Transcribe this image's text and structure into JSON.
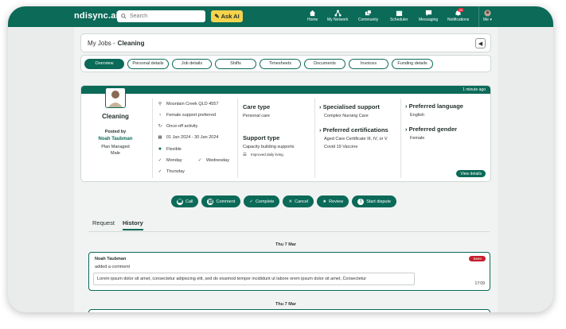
{
  "app": {
    "logo": "ndisync.ai"
  },
  "search": {
    "placeholder": "Search"
  },
  "ask_ai": {
    "label": "Ask AI"
  },
  "nav": [
    {
      "label": "Home",
      "icon": "home-icon"
    },
    {
      "label": "My Network",
      "icon": "network-icon"
    },
    {
      "label": "Community",
      "icon": "community-icon"
    },
    {
      "label": "Scheduler",
      "icon": "scheduler-icon"
    },
    {
      "label": "Messaging",
      "icon": "messaging-icon"
    },
    {
      "label": "Notifications",
      "icon": "bell-icon",
      "badge": "20"
    },
    {
      "label": "Me ▾",
      "icon": "avatar"
    }
  ],
  "breadcrumb": {
    "prefix": "My Jobs - ",
    "current": "Cleaning"
  },
  "tabs": [
    "Overview",
    "Personal details",
    "Job details",
    "Shifts",
    "Timesheets",
    "Documents",
    "Invoices",
    "Funding details"
  ],
  "job": {
    "posted_ago": "1 minute ago",
    "title": "Cleaning",
    "posted_by_label": "Posted by",
    "poster": "Noah Taubman",
    "plan": "Plan Managed",
    "gender": "Male",
    "location": "Mountain Creek QLD 4557",
    "support_pref": "Female support preferred",
    "frequency": "Once-off activity",
    "dates": "01 Jan 2024  -  30 Jan 2024",
    "flex": "Flexible",
    "days": [
      "Monday",
      "Wednesday",
      "Thursday"
    ],
    "care_type_label": "Care type",
    "care_type": "Personal care",
    "support_type_label": "Support type",
    "support_type": "Capacity building supports",
    "support_sub": "Improved daily living",
    "specialised_label": "Specialised support",
    "specialised": "Complex Nursing Care",
    "certs_label": "Preferred certifications",
    "certs_1": "Aged Care Certificate III, IV, or V",
    "certs_2": "Covid 19 Vaccine",
    "lang_label": "Preferred language",
    "lang": "English",
    "gender_label": "Preferred gender",
    "pref_gender": "Female",
    "view_details": "View details"
  },
  "actions": [
    "Call",
    "Comment",
    "Complete",
    "Cancel",
    "Review",
    "Start dispute"
  ],
  "subtabs": [
    "Request",
    "History"
  ],
  "history": {
    "date1": "Thu 7 Mar",
    "date2": "Thu 7 Mar",
    "author": "Noah Taubman",
    "action": "added a comment",
    "text": "Lorem ipsum dolor sit amet, consectetur adipiscing elit, sed do eiusmod tempor incididunt ut labore orem ipsum dolor sit amet, Consectetur",
    "tag": "Seen",
    "time": "17:09"
  },
  "colors": {
    "brand": "#0b6a58",
    "accent": "#f4d34d",
    "alert": "#c5202e"
  }
}
